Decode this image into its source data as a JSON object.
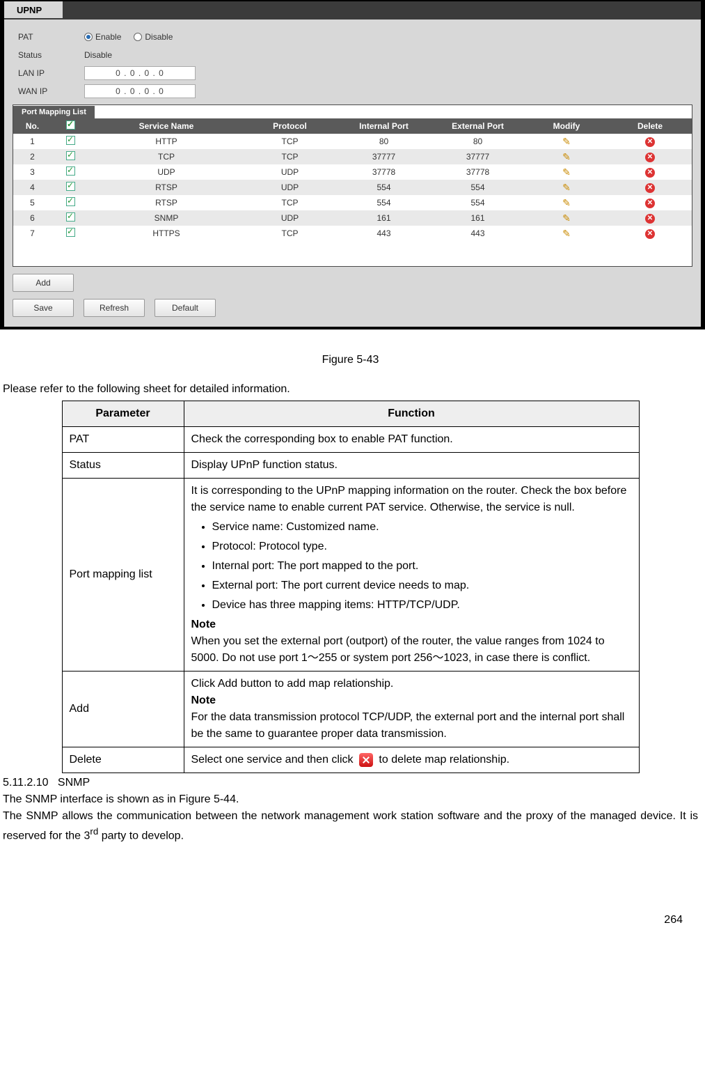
{
  "app": {
    "tab_label": "UPNP",
    "fields": {
      "pat_label": "PAT",
      "status_label": "Status",
      "lanip_label": "LAN IP",
      "wanip_label": "WAN IP",
      "enable_label": "Enable",
      "disable_label": "Disable",
      "status_value": "Disable",
      "lan_ip": "0  .  0  .  0  .  0",
      "wan_ip": "0  .  0  .  0  .  0"
    },
    "grid": {
      "caption": "Port Mapping List",
      "headers": {
        "no": "No.",
        "chk": "",
        "svc": "Service Name",
        "proto": "Protocol",
        "int": "Internal Port",
        "ext": "External Port",
        "mod": "Modify",
        "del": "Delete"
      },
      "rows": [
        {
          "no": "1",
          "svc": "HTTP",
          "proto": "TCP",
          "int": "80",
          "ext": "80"
        },
        {
          "no": "2",
          "svc": "TCP",
          "proto": "TCP",
          "int": "37777",
          "ext": "37777"
        },
        {
          "no": "3",
          "svc": "UDP",
          "proto": "UDP",
          "int": "37778",
          "ext": "37778"
        },
        {
          "no": "4",
          "svc": "RTSP",
          "proto": "UDP",
          "int": "554",
          "ext": "554"
        },
        {
          "no": "5",
          "svc": "RTSP",
          "proto": "TCP",
          "int": "554",
          "ext": "554"
        },
        {
          "no": "6",
          "svc": "SNMP",
          "proto": "UDP",
          "int": "161",
          "ext": "161"
        },
        {
          "no": "7",
          "svc": "HTTPS",
          "proto": "TCP",
          "int": "443",
          "ext": "443"
        }
      ]
    },
    "buttons": {
      "add": "Add",
      "save": "Save",
      "refresh": "Refresh",
      "default": "Default"
    }
  },
  "doc": {
    "figure_caption": "Figure 5-43",
    "intro": "Please refer to the following sheet for detailed information.",
    "th_param": "Parameter",
    "th_func": "Function",
    "rows": {
      "pat": {
        "p": "PAT",
        "f": "Check the corresponding box to enable PAT function."
      },
      "status": {
        "p": "Status",
        "f": "Display UPnP function status."
      },
      "pml": {
        "p": "Port mapping list",
        "intro": "It is corresponding to the UPnP mapping information on the router. Check the box before the service name to enable current PAT service. Otherwise, the service is null.",
        "b1": "Service name: Customized name.",
        "b2": "Protocol: Protocol type.",
        "b3": "Internal port: The port mapped to the port.",
        "b4": "External port: The port current device needs to map.",
        "b5": "Device has three mapping items: HTTP/TCP/UDP.",
        "note_label": "Note",
        "note_text": "When you set the external port (outport) of the router, the value ranges from 1024 to 5000. Do not use port 1～255 or system port 256～1023, in case there is conflict."
      },
      "add": {
        "p": "Add",
        "l1": "Click Add button to add map relationship.",
        "note_label": "Note",
        "l2": "For the data transmission protocol TCP/UDP, the external port and the internal port shall be the same to guarantee proper data transmission."
      },
      "del": {
        "p": "Delete",
        "pre": "Select one service and then click ",
        "post": " to delete map relationship."
      }
    },
    "section_num": "5.11.2.10",
    "section_title": "SNMP",
    "snmp_l1": "The SNMP interface is shown as in Figure 5-44.",
    "snmp_l2a": "The SNMP allows the communication between the network management work station software and the proxy of the managed device. It is reserved for the 3",
    "snmp_l2sup": "rd",
    "snmp_l2b": " party to develop.",
    "page_number": "264"
  }
}
